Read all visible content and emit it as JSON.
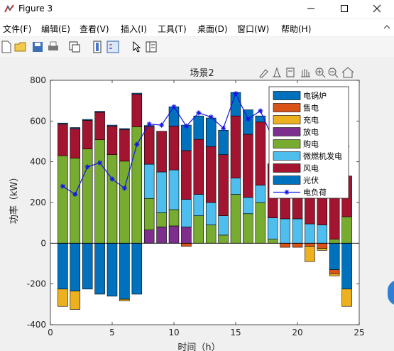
{
  "window": {
    "title": "Figure 3"
  },
  "menu": [
    "文件(F)",
    "编辑(E)",
    "查看(V)",
    "插入(I)",
    "工具(T)",
    "桌面(D)",
    "窗口(W)",
    "帮助(H)"
  ],
  "colors": {
    "电锅炉": "#0072BD",
    "售电": "#D95319",
    "充电": "#EDB120",
    "放电": "#7E2F8E",
    "购电": "#77AC30",
    "微燃机发电": "#4DBEEE",
    "风电": "#A2142F",
    "光伏": "#0072BD",
    "电负荷": "#1414e6"
  },
  "chart_data": {
    "type": "bar",
    "title": "场景2",
    "xlabel": "时间（h）",
    "ylabel": "功率（kW）",
    "xlim": [
      0,
      25
    ],
    "ylim": [
      -400,
      800
    ],
    "xticks": [
      0,
      5,
      10,
      15,
      20,
      25
    ],
    "yticks": [
      -400,
      -200,
      0,
      200,
      400,
      600,
      800
    ],
    "legend_position": "top-right",
    "legend": [
      "电锅炉",
      "售电",
      "充电",
      "放电",
      "购电",
      "微燃机发电",
      "风电",
      "光伏",
      "电负荷"
    ],
    "x": [
      1,
      2,
      3,
      4,
      5,
      6,
      7,
      8,
      9,
      10,
      11,
      12,
      13,
      14,
      15,
      16,
      17,
      18,
      19,
      20,
      21,
      22,
      23,
      24
    ],
    "positive_series": [
      {
        "name": "放电",
        "values": [
          0,
          0,
          0,
          0,
          0,
          0,
          0,
          65,
          80,
          85,
          80,
          0,
          0,
          0,
          0,
          0,
          0,
          0,
          0,
          0,
          0,
          0,
          0,
          0
        ]
      },
      {
        "name": "购电",
        "values": [
          430,
          418,
          463,
          508,
          435,
          403,
          572,
          155,
          70,
          80,
          0,
          135,
          90,
          40,
          240,
          145,
          200,
          20,
          0,
          0,
          0,
          0,
          20,
          130
        ]
      },
      {
        "name": "微燃机发电",
        "values": [
          0,
          0,
          0,
          0,
          0,
          0,
          0,
          168,
          200,
          195,
          135,
          105,
          110,
          95,
          80,
          80,
          85,
          105,
          120,
          120,
          95,
          90,
          0,
          0
        ]
      },
      {
        "name": "风电",
        "values": [
          155,
          145,
          140,
          135,
          140,
          155,
          160,
          185,
          200,
          215,
          240,
          270,
          275,
          300,
          305,
          310,
          310,
          265,
          265,
          265,
          250,
          240,
          270,
          200
        ]
      },
      {
        "name": "光伏",
        "values": [
          5,
          5,
          5,
          5,
          5,
          5,
          5,
          5,
          0,
          95,
          125,
          115,
          140,
          120,
          115,
          120,
          30,
          0,
          0,
          0,
          0,
          0,
          0,
          0
        ]
      }
    ],
    "negative_series": [
      {
        "name": "电锅炉",
        "values": [
          -225,
          -235,
          -225,
          -250,
          -260,
          -275,
          -250,
          0,
          0,
          0,
          0,
          0,
          0,
          0,
          0,
          0,
          0,
          0,
          0,
          0,
          0,
          0,
          -130,
          -225
        ]
      },
      {
        "name": "售电",
        "values": [
          0,
          0,
          0,
          0,
          0,
          0,
          0,
          0,
          0,
          0,
          -15,
          0,
          0,
          0,
          0,
          0,
          0,
          0,
          -20,
          -20,
          -15,
          -25,
          -20,
          0
        ]
      },
      {
        "name": "充电",
        "values": [
          -85,
          -90,
          0,
          0,
          0,
          -8,
          0,
          0,
          0,
          0,
          0,
          0,
          0,
          0,
          0,
          0,
          0,
          0,
          0,
          0,
          -75,
          -10,
          -10,
          -85
        ]
      }
    ],
    "line_series": {
      "name": "电负荷",
      "values": [
        280,
        240,
        375,
        395,
        315,
        270,
        485,
        585,
        580,
        670,
        575,
        640,
        620,
        565,
        735,
        610,
        650,
        515,
        480,
        470,
        455,
        470,
        480,
        475
      ]
    }
  }
}
